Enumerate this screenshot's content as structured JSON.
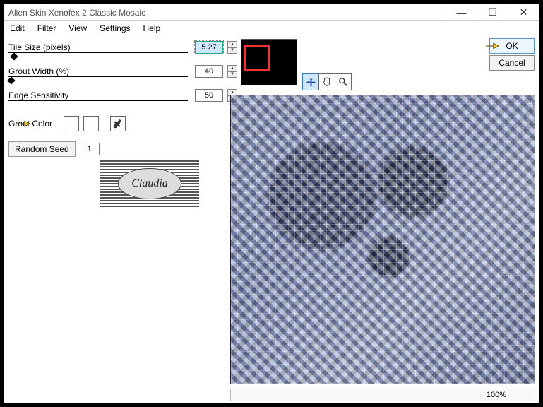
{
  "window": {
    "title": "Alien Skin Xenofex 2 Classic Mosaic",
    "minimize": "—",
    "maximize": "☐",
    "close": "✕"
  },
  "menu": {
    "edit": "Edit",
    "filter": "Filter",
    "view": "View",
    "settings": "Settings",
    "help": "Help"
  },
  "params": {
    "tile_size_label": "Tile Size (pixels)",
    "tile_size_value": "5.27",
    "grout_width_label": "Grout Width (%)",
    "grout_width_value": "40",
    "edge_sensitivity_label": "Edge Sensitivity",
    "edge_sensitivity_value": "50",
    "grout_color_label": "Grout Color",
    "grout_color_hex": "#8ea0d8",
    "grout_white_hex": "#ffffff",
    "random_seed_label": "Random Seed",
    "random_seed_value": "1"
  },
  "buttons": {
    "ok": "OK",
    "cancel": "Cancel"
  },
  "status": {
    "zoom": "100%"
  },
  "tools": {
    "move": "move-tool",
    "hand": "hand-tool",
    "zoom": "zoom-tool"
  },
  "logo": {
    "text": "Claudia"
  }
}
